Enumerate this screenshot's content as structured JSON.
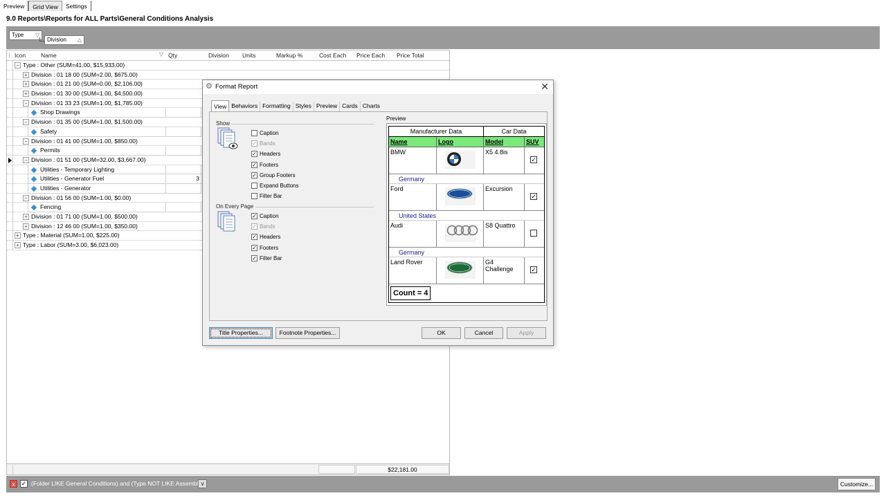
{
  "tabs": [
    "Preview",
    "Grid View",
    "Settings"
  ],
  "page_title": "9.0 Reports\\Reports for ALL Parts\\General Conditions Analysis",
  "group_band": {
    "chips": [
      {
        "label": "Type",
        "arrow": "▽"
      },
      {
        "label": "Division",
        "arrow": "△"
      }
    ]
  },
  "grid": {
    "columns": [
      "Icon",
      "Name",
      "Qty",
      "Division",
      "Units",
      "Markup %",
      "Cost Each",
      "Price Each",
      "Price Total"
    ],
    "rows": [
      {
        "level": 0,
        "expander": "⊟",
        "text": "Type : Other (SUM=41.00, $15,933.00)"
      },
      {
        "level": 1,
        "expander": "⊞",
        "text": "Division : 01 18 00 (SUM=2.00, $675.00)"
      },
      {
        "level": 1,
        "expander": "⊞",
        "text": "Division : 01 21 00 (SUM=0.00, $2,106.00)"
      },
      {
        "level": 1,
        "expander": "⊞",
        "text": "Division : 01 30 00 (SUM=1.00, $4,500.00)"
      },
      {
        "level": 1,
        "expander": "⊟",
        "text": "Division : 01 33 23 (SUM=1.00, $1,785.00)"
      },
      {
        "level": 2,
        "text": "Shop Drawings",
        "qty": ""
      },
      {
        "level": 1,
        "expander": "⊟",
        "text": "Division : 01 35 00 (SUM=1.00, $1,500.00)"
      },
      {
        "level": 2,
        "text": "Safety",
        "qty": ""
      },
      {
        "level": 1,
        "expander": "⊟",
        "text": "Division : 01 41 00 (SUM=1.00, $850.00)"
      },
      {
        "level": 2,
        "text": "Permits",
        "qty": ""
      },
      {
        "level": 1,
        "expander": "⊟",
        "text": "Division : 01 51 00 (SUM=32.00, $3,667.00)",
        "current": true
      },
      {
        "level": 2,
        "text": "Utilities - Temporary Lighting",
        "qty": ""
      },
      {
        "level": 2,
        "text": "Utilities - Generator Fuel",
        "qty": "3"
      },
      {
        "level": 2,
        "text": "Utilities - Generator",
        "qty": ""
      },
      {
        "level": 1,
        "expander": "⊟",
        "text": "Division : 01 56 00 (SUM=1.00, $0.00)"
      },
      {
        "level": 2,
        "text": "Fencing",
        "qty": ""
      },
      {
        "level": 1,
        "expander": "⊞",
        "text": "Division : 01 71 00 (SUM=1.00, $500.00)"
      },
      {
        "level": 1,
        "expander": "⊞",
        "text": "Division : 12 46 00 (SUM=1.00, $350.00)"
      },
      {
        "level": 0,
        "expander": "⊞",
        "text": "Type : Material (SUM=1.00, $225.00)"
      },
      {
        "level": 0,
        "expander": "⊞",
        "text": "Type : Labor (SUM=3.00, $6,023.00)"
      }
    ],
    "footer_total": "$22,181.00"
  },
  "filter_bar": {
    "close": "x",
    "check": "✓",
    "text": "(Folder LIKE General Conditions) and (Type NOT LIKE Assembly)",
    "dropdown": "∨",
    "customize": "Customize..."
  },
  "dialog": {
    "title": "Format Report",
    "close": "✕",
    "tabs": [
      "View",
      "Behaviors",
      "Formatting",
      "Styles",
      "Preview",
      "Cards",
      "Charts"
    ],
    "show_label": "Show",
    "show_items": [
      {
        "label": "Caption",
        "checked": false,
        "disabled": false
      },
      {
        "label": "Bands",
        "checked": true,
        "disabled": true
      },
      {
        "label": "Headers",
        "checked": true,
        "disabled": false
      },
      {
        "label": "Footers",
        "checked": true,
        "disabled": false
      },
      {
        "label": "Group Footers",
        "checked": true,
        "disabled": false
      },
      {
        "label": "Expand Buttons",
        "checked": false,
        "disabled": false
      },
      {
        "label": "Filter Bar",
        "checked": false,
        "disabled": false
      }
    ],
    "every_page_label": "On Every Page",
    "every_page_items": [
      {
        "label": "Caption",
        "checked": true,
        "disabled": false
      },
      {
        "label": "Bands",
        "checked": true,
        "disabled": true
      },
      {
        "label": "Headers",
        "checked": true,
        "disabled": false
      },
      {
        "label": "Footers",
        "checked": true,
        "disabled": false
      },
      {
        "label": "Filter Bar",
        "checked": true,
        "disabled": false
      }
    ],
    "preview_label": "Preview",
    "preview": {
      "bands": [
        "Manufacturer Data",
        "Car Data"
      ],
      "headers": [
        "Name",
        "Logo",
        "Model",
        "SUV"
      ],
      "records": [
        {
          "name": "BMW",
          "logo": "bmw-logo",
          "model": "X5 4.8is",
          "suv": true,
          "group": "Germany"
        },
        {
          "name": "Ford",
          "logo": "ford-logo",
          "model": "Excursion",
          "suv": true,
          "group": "United States"
        },
        {
          "name": "Audi",
          "logo": "audi-logo",
          "model": "S8 Quattro",
          "suv": false,
          "group": "Germany"
        },
        {
          "name": "Land Rover",
          "logo": "land-rover-logo",
          "model": "G4 Challenge",
          "suv": true,
          "group": ""
        }
      ],
      "count": "Count = 4"
    },
    "buttons": {
      "title_props": "Title Properties...",
      "footnote_props": "Footnote Properties...",
      "ok": "OK",
      "cancel": "Cancel",
      "apply": "Apply"
    }
  },
  "colors": {
    "band_gray": "#9a9a9a",
    "preview_header_green": "#7be87b",
    "group_text_blue": "#1a1a8c",
    "diamond_blue": "#3a8fd4"
  }
}
